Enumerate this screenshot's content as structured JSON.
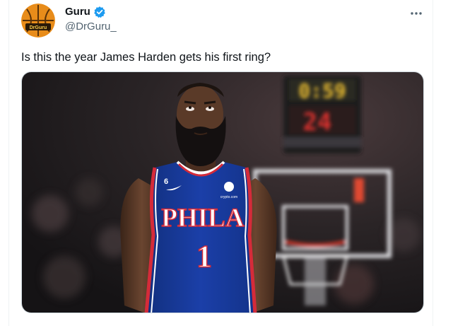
{
  "tweet": {
    "display_name": "Guru",
    "handle": "@DrGuru_",
    "text": "Is this the year James Harden gets his first ring?",
    "verified": true,
    "avatar_text": "DrGuru",
    "colors": {
      "verified": "#1d9bf0",
      "avatar_bg": "#e88c1a",
      "secondary_text": "#536471"
    }
  },
  "media": {
    "scoreboard_top": "0:59",
    "scoreboard_bottom": "24",
    "jersey_team": "PHILA",
    "jersey_number": "1",
    "jersey_collar_number": "6",
    "sponsor_text": "crypto.com",
    "colors": {
      "jersey": "#1b3fa8",
      "jersey_trim": "#d52b3a",
      "scoreboard_yellow": "#f2c230",
      "scoreboard_red": "#e0322f"
    }
  },
  "icons": {
    "more": "more-icon",
    "verified": "verified-badge-icon",
    "avatar": "basketball-avatar"
  }
}
